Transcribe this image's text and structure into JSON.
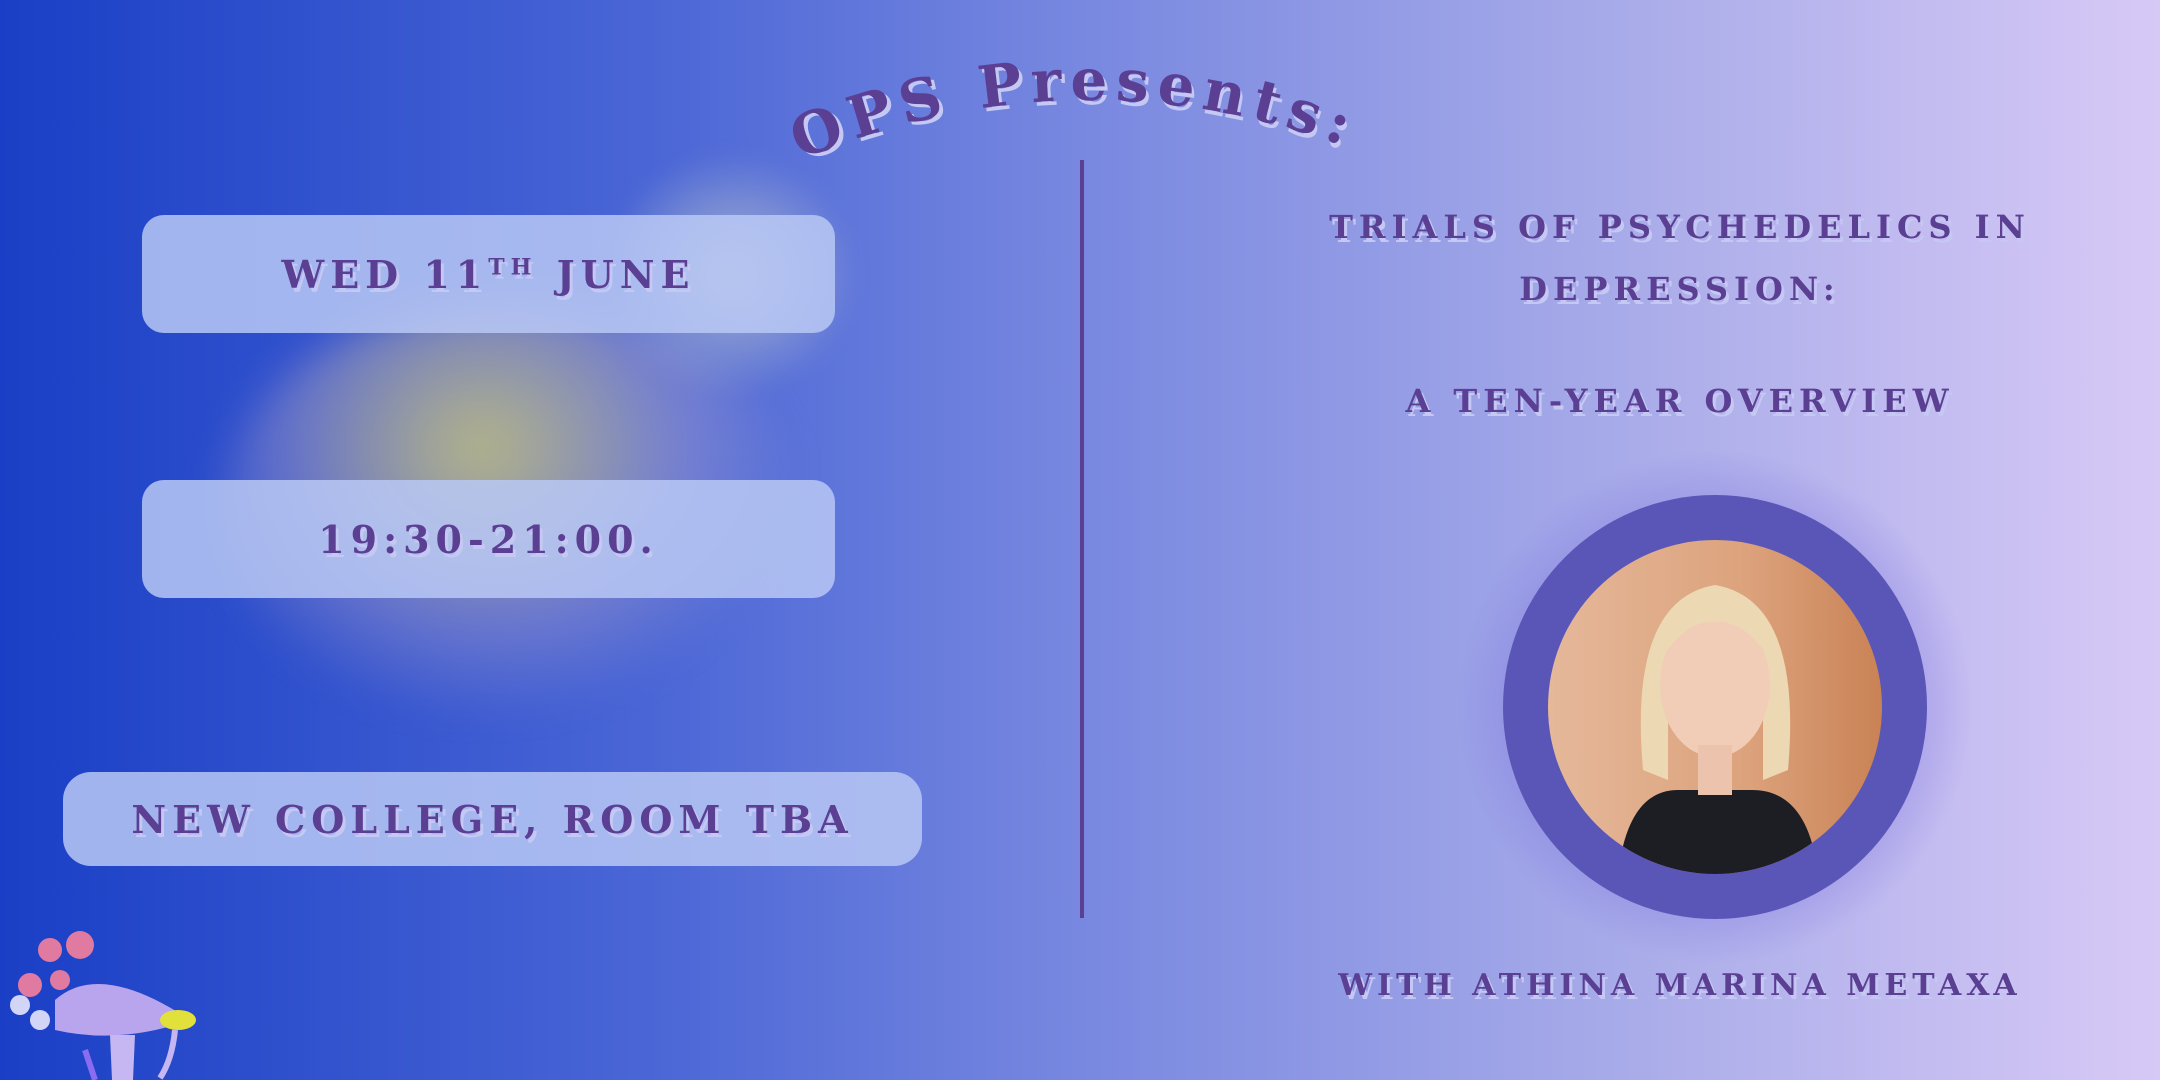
{
  "header": {
    "title": "OPS Presents:"
  },
  "event": {
    "date_day": "Wed 11",
    "date_suffix": "th",
    "date_month": "June",
    "time": "19:30-21:00.",
    "location": "New College, Room TBA"
  },
  "talk": {
    "title_line1": "Trials of Psychedelics in",
    "title_line2": "Depression:",
    "subtitle": "A Ten-Year Overview",
    "speaker": "With Athina Marina Metaxa"
  },
  "colors": {
    "text": "#5b3f93",
    "ring": "#5a56b8"
  },
  "decor": {
    "icon": "mushroom-illustration-icon"
  }
}
